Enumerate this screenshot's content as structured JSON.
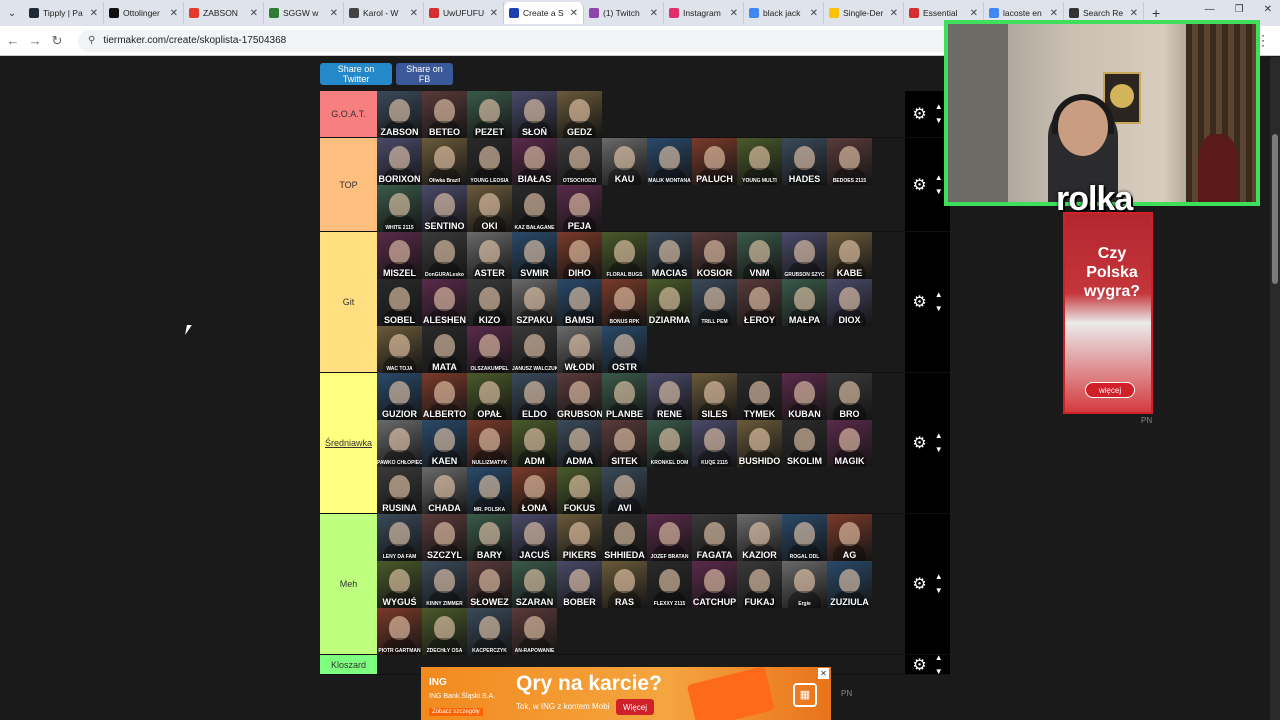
{
  "browser": {
    "tabs": [
      {
        "label": "Tipply | Pa",
        "color": "#1f2937"
      },
      {
        "label": "Ottolinger",
        "color": "#111111"
      },
      {
        "label": "ZABSON",
        "color": "#e33b2e"
      },
      {
        "label": "SGGW w",
        "color": "#2e7d32"
      },
      {
        "label": "Karol - W",
        "color": "#444444"
      },
      {
        "label": "UwUFUFU",
        "color": "#d32f2f"
      },
      {
        "label": "Create a S",
        "color": "#1e40af",
        "active": true
      },
      {
        "label": "(1) Twitch",
        "color": "#8e44ad"
      },
      {
        "label": "Instagram",
        "color": "#e1306c"
      },
      {
        "label": "black jack",
        "color": "#4285f4"
      },
      {
        "label": "Single-Der",
        "color": "#ffc107"
      },
      {
        "label": "Essential",
        "color": "#d32f2f"
      },
      {
        "label": "lacoste en",
        "color": "#4285f4"
      },
      {
        "label": "Search Re",
        "color": "#333333"
      }
    ],
    "url": "tiermaker.com/create/skoplista-17504368"
  },
  "share": {
    "twitter": "Share on Twitter",
    "fb": "Share on FB"
  },
  "tiers": [
    {
      "label": "G.O.A.T.",
      "color": "#f77f7f",
      "items": [
        "ZABSON",
        "BETEO",
        "PEZET",
        "SŁOŃ",
        "GEDZ"
      ]
    },
    {
      "label": "TOP",
      "color": "#ffbf7f",
      "items": [
        "BORIXON",
        "Oliwka Brazil",
        "YOUNG LEOSIA",
        "BIAŁAS",
        "OTSOCHODZI",
        "KAU",
        "MALIK MONTANA",
        "PALUCH",
        "YOUNG MULTI",
        "HADES",
        "BEDOES 2115",
        "WHITE 2115",
        "SENTINO",
        "OKI",
        "KAZ BAŁAGANE",
        "PEJA"
      ]
    },
    {
      "label": "Git",
      "color": "#ffdf7f",
      "items": [
        "MISZEL",
        "DonGURALesko",
        "ASTER",
        "SVMIR",
        "DIHO",
        "FLORAL BUGS",
        "MACIAS",
        "KOSIOR",
        "VNM",
        "GRUBSON SZYC",
        "KABE",
        "SOBEL",
        "ALESHEN",
        "KIZO",
        "SZPAKU",
        "BAMSI",
        "BONUS RPK",
        "DZIARMA",
        "TRILL PEM",
        "ŁEROY",
        "MAŁPA",
        "DIOX",
        "WAC TOJA",
        "MATA",
        "OLSZAKUMPEL",
        "JANUSZ WALCZUK",
        "WŁODI",
        "OSTR"
      ]
    },
    {
      "label": "Średniawka",
      "color": "#ffff7f",
      "items": [
        "GUZIOR",
        "ALBERTO",
        "OPAŁ",
        "ELDO",
        "GRUBSON",
        "PLANBE",
        "RENE",
        "SILES",
        "TYMEK",
        "KUBAN",
        "BRO",
        "PAWKO CHŁOPIEC",
        "KAEN",
        "NULLIZMATYK",
        "ADM",
        "ADMA",
        "SITEK",
        "KRONKEL DOM",
        "KUQE 2115",
        "BUSHIDO",
        "SKOLIM",
        "MAGIK",
        "RUSINA",
        "CHADA",
        "MR. POLSKA",
        "ŁONA",
        "FOKUS",
        "AVI"
      ]
    },
    {
      "label": "Meh",
      "color": "#bfff7f",
      "items": [
        "LENY DA FAM",
        "SZCZYL",
        "BARY",
        "JACUŚ",
        "PIKERS",
        "SHHIEDA",
        "JÓZEF BRATAN",
        "FAGATA",
        "KAZIOR",
        "ROGAL DDL",
        "AG",
        "WYGUŚ",
        "KINNY ZIMMER",
        "SŁOWEZ",
        "SZARAN",
        "BOBER",
        "RAS",
        "FLEXXY 2115",
        "CATCHUP",
        "FUKAJ",
        "Ergie",
        "ZUZIULA",
        "PIOTR GARTMAN",
        "ZDECHŁY OSA",
        "KACPERCZYK",
        "AN-RAPOWANIE"
      ]
    },
    {
      "label": "Kloszard",
      "color": "#7fff7f",
      "items": []
    }
  ],
  "overlay": {
    "rolka": "rolka"
  },
  "side_ad": {
    "text": "Czy Polska wygra?",
    "button": "więcej",
    "pn": "PN"
  },
  "bottom_ad": {
    "brand": "ING",
    "bank": "ING Bank Śląski S.A.",
    "headline": "Qry na karcie?",
    "sub": "Tok, w ING z kontem Mobi",
    "button": "Więcej",
    "zob": "Zobacz szczegóły",
    "pn": "PN"
  }
}
